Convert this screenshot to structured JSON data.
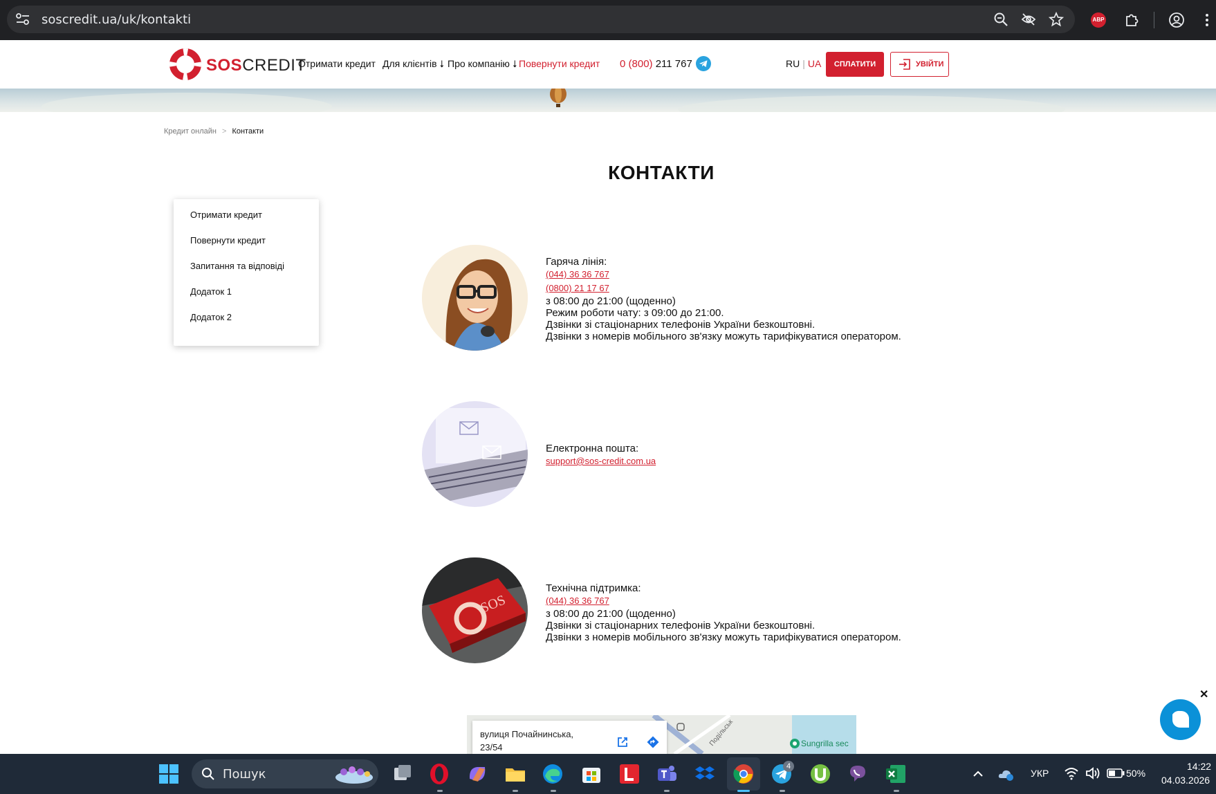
{
  "browser": {
    "url": "soscredit.ua/uk/kontakti",
    "extension_badge": "ABP"
  },
  "header": {
    "brand_sos": "SOS",
    "brand_credit": "CREDIT",
    "nav": [
      {
        "label": "Отримати кредит"
      },
      {
        "label": "Для клієнтів ⭣"
      },
      {
        "label": "Про компанію ⭣"
      },
      {
        "label": "Повернути кредит"
      }
    ],
    "phone_prefix": "0 (800)",
    "phone_number": " 211 767",
    "lang_ru": "RU",
    "lang_sep": "|",
    "lang_ua": "UA",
    "pay_button": "СПЛАТИТИ",
    "login_button": "УВІЙТИ"
  },
  "breadcrumbs": {
    "home": "Кредит онлайн",
    "arrow": ">",
    "current": "Контакти"
  },
  "page_title": "КОНТАКТИ",
  "side_menu": [
    {
      "label": "Отримати кредит"
    },
    {
      "label": "Повернути кредит"
    },
    {
      "label": "Запитання та відповіді"
    },
    {
      "label": "Додаток 1"
    },
    {
      "label": "Додаток 2"
    }
  ],
  "hotline": {
    "title": "Гаряча лінія:",
    "phone1": "(044) 36 36 767 ",
    "phone2": "(0800) 21 17 67",
    "hours": "з 08:00 до 21:00 (щоденно)",
    "chat_hours": "Режим роботи чату: з 09:00 до 21:00.",
    "note1": "Дзвінки зі стаціонарних телефонів України безкоштовні.",
    "note2": "Дзвінки з номерів мобільного зв'язку можуть тарифікуватися оператором."
  },
  "email": {
    "title": "Електронна пошта:",
    "address": "support@sos-credit.com.ua"
  },
  "support": {
    "title": "Технічна підтримка:",
    "phone": "(044) 36 36 767",
    "hours": "з 08:00 до 21:00 (щоденно)",
    "note1": "Дзвінки зі стаціонарних телефонів України безкоштовні.",
    "note2": "Дзвінки з номерів мобільного зв'язку можуть тарифікуватися оператором."
  },
  "map": {
    "address_line1": "вулиця Почайнинська,",
    "address_line2": "23/54",
    "street_label": "Подільськ",
    "poi_label": "Sungrilla sec"
  },
  "chat_close": "✕",
  "taskbar": {
    "search_placeholder": "Пошук",
    "telegram_badge": "4",
    "lang": "УКР",
    "battery": "50%",
    "time": "14:22",
    "date": "04.03.2026"
  },
  "colors": {
    "brand_red": "#d2202f",
    "chat_blue": "#0b91d8"
  }
}
